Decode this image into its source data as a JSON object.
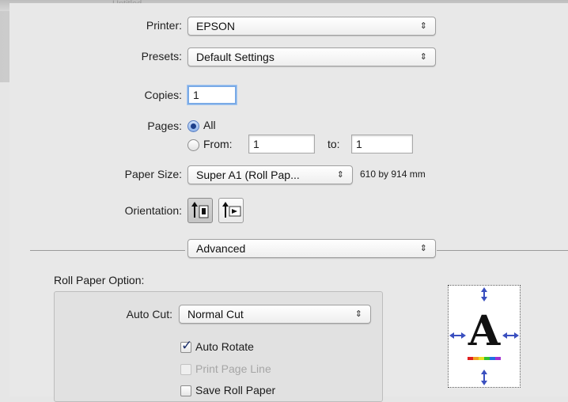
{
  "window": {
    "ghost_title": "Untitled"
  },
  "printer": {
    "label": "Printer:",
    "value": "EPSON"
  },
  "presets": {
    "label": "Presets:",
    "value": "Default Settings"
  },
  "copies": {
    "label": "Copies:",
    "value": "1"
  },
  "pages": {
    "label": "Pages:",
    "all_label": "All",
    "from_label": "From:",
    "from_value": "1",
    "to_label": "to:",
    "to_value": "1",
    "selected": "All"
  },
  "paper_size": {
    "label": "Paper Size:",
    "value": "Super A1 (Roll Pap...",
    "dimensions": "610 by 914 mm"
  },
  "orientation": {
    "label": "Orientation:",
    "selected": "portrait"
  },
  "panel": {
    "value": "Advanced"
  },
  "roll_paper": {
    "section_label": "Roll Paper Option:",
    "auto_cut_label": "Auto Cut:",
    "auto_cut_value": "Normal Cut",
    "auto_rotate_label": "Auto Rotate",
    "auto_rotate_checked": true,
    "print_page_line_label": "Print Page Line",
    "print_page_line_enabled": false,
    "save_roll_paper_label": "Save Roll Paper",
    "save_roll_paper_checked": false
  },
  "preview": {
    "letter": "A"
  },
  "popup_arrows": "⇕",
  "colors": {
    "accent": "#1d3f8a",
    "focus_ring": "#7aaae6",
    "preview_arrow": "#3a4fbf"
  }
}
